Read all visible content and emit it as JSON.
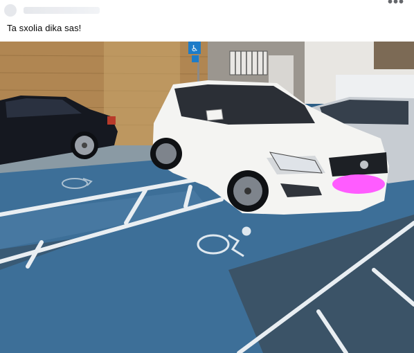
{
  "post": {
    "caption": "Ta sxolia dika sas!",
    "menu_label": "•••"
  },
  "photo": {
    "parking_sign_symbol": "♿",
    "subject": "white SUV occupying a disabled parking space",
    "colors": {
      "wall": "#b28a55",
      "asphalt_blue": "#3b6e98",
      "car_white": "#f4f4f2",
      "plate_mask": "#ff5cff",
      "dark_car": "#151820"
    },
    "icons": [
      "wheelchair-icon",
      "parking-sign-icon"
    ]
  }
}
